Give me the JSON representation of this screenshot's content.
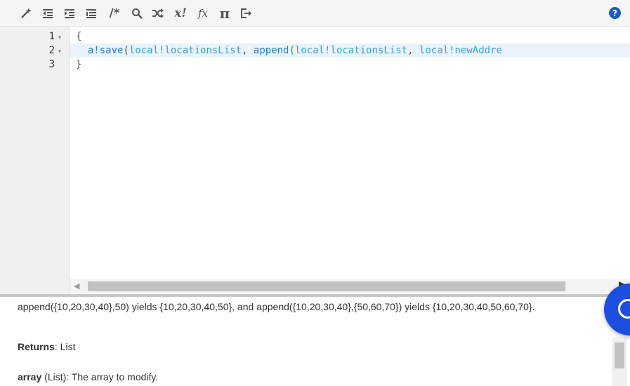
{
  "toolbar": {
    "icons": [
      "magic-wand-icon",
      "outdent-icon",
      "indent-icon",
      "list-icon",
      "comment-icon",
      "search-icon",
      "shuffle-icon",
      "x-bang-icon",
      "function-icon",
      "pi-icon",
      "exit-icon"
    ],
    "comment_glyph": "/*",
    "xbang_glyph": "x!",
    "fx_glyph": "fx",
    "pi_glyph": "π",
    "help_glyph": "?"
  },
  "editor": {
    "lines": [
      {
        "num": "1",
        "fold": "▾",
        "text": "{"
      },
      {
        "num": "2",
        "fold": "▾",
        "prefix": "  ",
        "fn": "a!save",
        "open": "(",
        "arg1": "local!locationsList",
        "sep": ", ",
        "fn2": "append",
        "open2": "(",
        "arg2": "local!locationsList",
        "sep2": ", ",
        "arg3": "local!newAddre"
      },
      {
        "num": "3",
        "fold": "",
        "text": "}"
      }
    ]
  },
  "doc": {
    "example": "append({10,20,30,40},50) yields {10,20,30,40,50}, and append({10,20,30,40},{50,60,70}) yields {10,20,30,40,50,60,70}.",
    "returns_label": "Returns",
    "returns_value": ": List",
    "param_name": "array",
    "param_desc": " (List): The array to modify."
  },
  "colors": {
    "function": "#1a7fc1",
    "variable": "#3aa3d8",
    "paren_match": "#2ecc71",
    "fab": "#1d4ee0",
    "help": "#1f5fb4"
  }
}
